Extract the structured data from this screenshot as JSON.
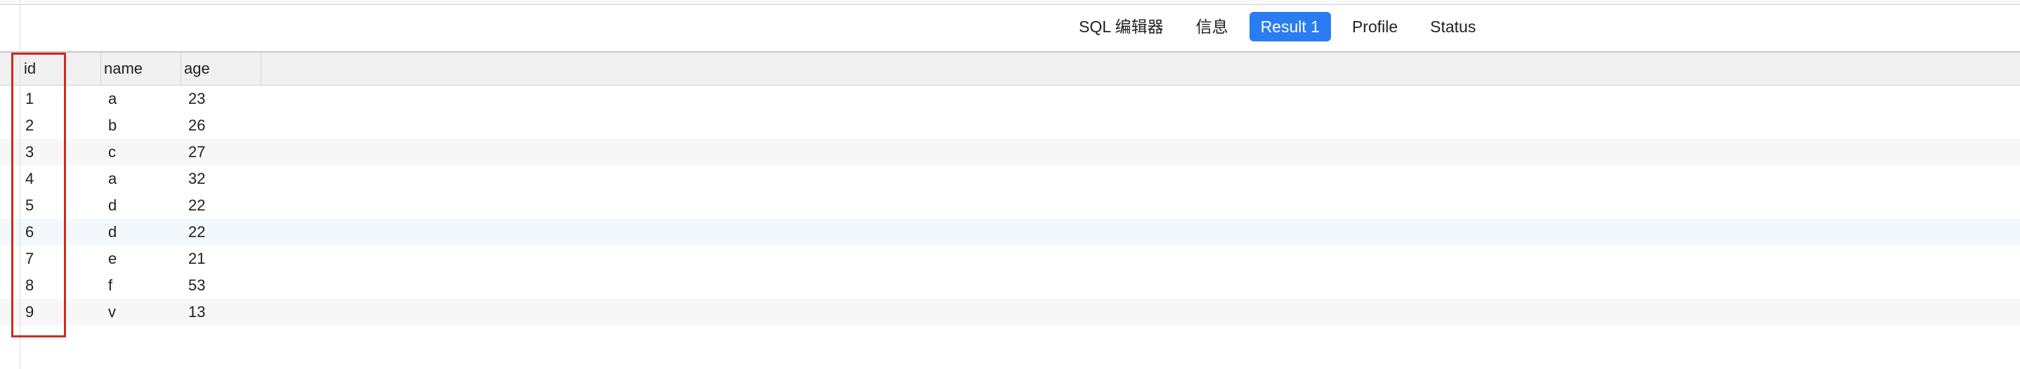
{
  "toolbar": {
    "tabs": [
      {
        "label": "SQL 编辑器",
        "active": false
      },
      {
        "label": "信息",
        "active": false
      },
      {
        "label": "Result 1",
        "active": true
      },
      {
        "label": "Profile",
        "active": false
      },
      {
        "label": "Status",
        "active": false
      }
    ]
  },
  "colors": {
    "active_tab": "#2a7cf3",
    "highlight_box": "#d0281f"
  },
  "table": {
    "columns": [
      "id",
      "name",
      "age"
    ],
    "rows": [
      {
        "id": "1",
        "name": "a",
        "age": "23"
      },
      {
        "id": "2",
        "name": "b",
        "age": "26"
      },
      {
        "id": "3",
        "name": "c",
        "age": "27"
      },
      {
        "id": "4",
        "name": "a",
        "age": "32"
      },
      {
        "id": "5",
        "name": "d",
        "age": "22"
      },
      {
        "id": "6",
        "name": "d",
        "age": "22"
      },
      {
        "id": "7",
        "name": "e",
        "age": "21"
      },
      {
        "id": "8",
        "name": "f",
        "age": "53"
      },
      {
        "id": "9",
        "name": "v",
        "age": "13"
      }
    ]
  }
}
